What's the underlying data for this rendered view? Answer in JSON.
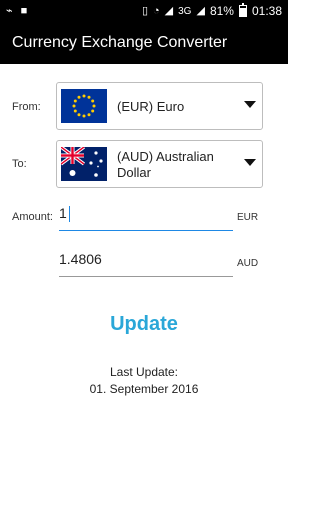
{
  "status": {
    "battery": "81%",
    "time": "01:38",
    "network": "3G"
  },
  "app": {
    "title": "Currency Exchange Converter"
  },
  "form": {
    "from_label": "From:",
    "to_label": "To:",
    "from_currency": "(EUR) Euro",
    "to_currency": "(AUD) Australian Dollar",
    "amount_label": "Amount:",
    "amount_value": "1",
    "amount_unit": "EUR",
    "result_value": "1.4806",
    "result_unit": "AUD"
  },
  "actions": {
    "update_label": "Update"
  },
  "last_update": {
    "label": "Last Update:",
    "date": "01. September 2016"
  },
  "colors": {
    "accent": "#2aa7d8",
    "input_focus": "#1e88e5",
    "eu_blue": "#003399",
    "eu_gold": "#ffcc00",
    "au_blue": "#012169",
    "au_red": "#e4002b"
  }
}
